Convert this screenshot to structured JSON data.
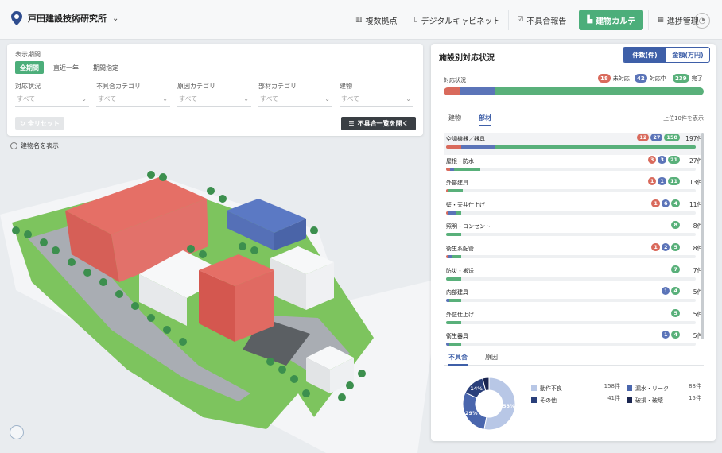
{
  "header": {
    "site_name": "戸田建設技術研究所",
    "nav": [
      {
        "label": "複数拠点",
        "icon": "map-icon"
      },
      {
        "label": "デジタルキャビネット",
        "icon": "document-icon"
      },
      {
        "label": "不具合報告",
        "icon": "checkbox-icon"
      },
      {
        "label": "建物カルテ",
        "icon": "building-icon",
        "active": true
      },
      {
        "label": "進捗管理",
        "icon": "calendar-icon"
      }
    ]
  },
  "filters": {
    "period_label": "表示期間",
    "period_options": [
      "全期間",
      "直近一年",
      "期間指定"
    ],
    "status_label": "対応状況",
    "defect_cat_label": "不具合カテゴリ",
    "cause_cat_label": "原因カテゴリ",
    "part_cat_label": "部材カテゴリ",
    "building_label": "建物",
    "placeholder": "すべて",
    "reset_label": "全リセット",
    "open_list_label": "不具合一覧を開く",
    "show_building_names": "建物名を表示"
  },
  "panel": {
    "title": "施設別対応状況",
    "seg_count": "件数(件)",
    "seg_amount": "金額(万円)",
    "status_label": "対応状況",
    "status": [
      {
        "label": "未対応",
        "count": "18",
        "color": "#d96a5c"
      },
      {
        "label": "対応中",
        "count": "42",
        "color": "#5b74b8"
      },
      {
        "label": "完了",
        "count": "239",
        "color": "#59b07a"
      }
    ],
    "tab_building": "建物",
    "tab_part": "部材",
    "top10_label": "上位10件を表示",
    "unit": "件",
    "items": [
      {
        "name": "空調機器／器具",
        "red": "12",
        "blue": "27",
        "green": "158",
        "total": "197"
      },
      {
        "name": "屋根・防水",
        "red": "3",
        "blue": "3",
        "green": "21",
        "total": "27"
      },
      {
        "name": "外部建具",
        "red": "1",
        "blue": "1",
        "green": "11",
        "total": "13"
      },
      {
        "name": "壁・天井仕上げ",
        "red": "1",
        "blue": "6",
        "green": "4",
        "total": "11"
      },
      {
        "name": "照明・コンセント",
        "red": "",
        "blue": "",
        "green": "8",
        "total": "8"
      },
      {
        "name": "衛生系配管",
        "red": "1",
        "blue": "2",
        "green": "5",
        "total": "8"
      },
      {
        "name": "防災・搬送",
        "red": "",
        "blue": "",
        "green": "7",
        "total": "7"
      },
      {
        "name": "内部建具",
        "red": "",
        "blue": "1",
        "green": "4",
        "total": "5"
      },
      {
        "name": "外壁仕上げ",
        "red": "",
        "blue": "",
        "green": "5",
        "total": "5"
      },
      {
        "name": "衛生器具",
        "red": "",
        "blue": "1",
        "green": "4",
        "total": "5"
      }
    ],
    "tab_defect": "不具合",
    "tab_cause": "原因",
    "donut": [
      {
        "label": "動作不良",
        "value": "158件",
        "pct": 53,
        "color": "#b8c7e6",
        "text": "53%"
      },
      {
        "label": "漏水・リーク",
        "value": "88件",
        "pct": 29,
        "color": "#4a66ad",
        "text": "29%"
      },
      {
        "label": "その他",
        "value": "41件",
        "pct": 14,
        "color": "#2a3f7a",
        "text": "14%"
      },
      {
        "label": "破損・破壊",
        "value": "15件",
        "pct": 4,
        "color": "#1a2550",
        "text": ""
      }
    ]
  }
}
